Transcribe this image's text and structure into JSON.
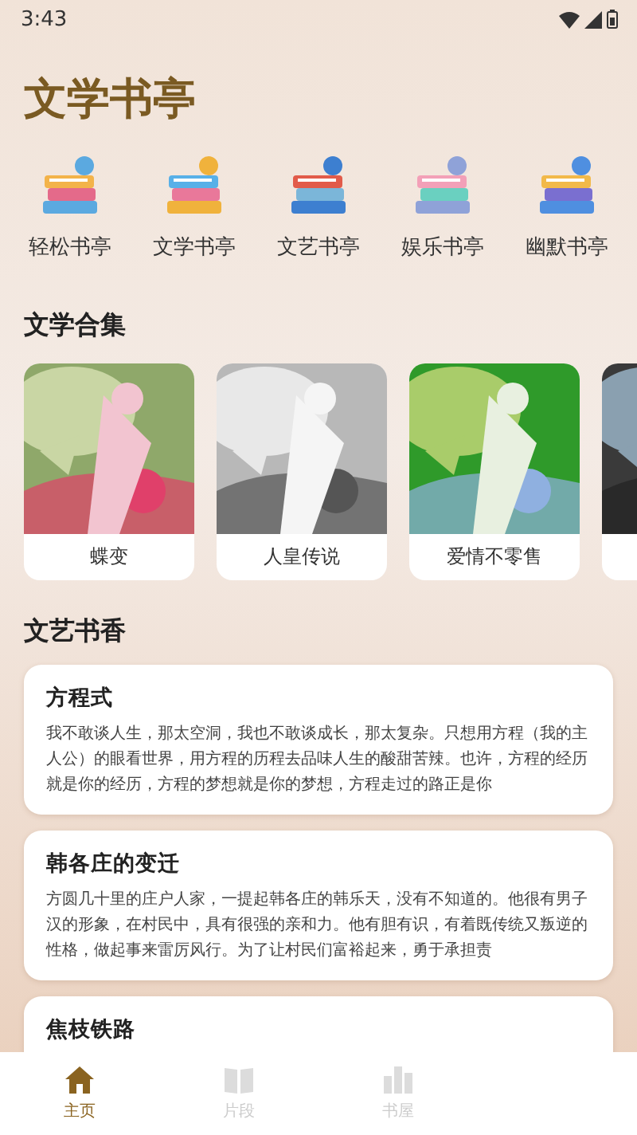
{
  "status_bar": {
    "time": "3:43"
  },
  "app_title": "文学书亭",
  "categories": [
    {
      "label": "轻松书亭"
    },
    {
      "label": "文学书亭"
    },
    {
      "label": "文艺书亭"
    },
    {
      "label": "娱乐书亭"
    },
    {
      "label": "幽默书亭"
    }
  ],
  "collection": {
    "title": "文学合集",
    "books": [
      {
        "title": "蝶变",
        "kind": "picture"
      },
      {
        "title": "人皇传说",
        "kind": "picture"
      },
      {
        "title": "爱情不零售",
        "kind": "picture"
      },
      {
        "kind": "picture"
      }
    ]
  },
  "articles": {
    "title": "文艺书香",
    "items": [
      {
        "title": "方程式",
        "excerpt": "我不敢谈人生，那太空洞，我也不敢谈成长，那太复杂。只想用方程（我的主人公）的眼看世界，用方程的历程去品味人生的酸甜苦辣。也许，方程的经历就是你的经历，方程的梦想就是你的梦想，方程走过的路正是你"
      },
      {
        "title": "韩各庄的变迁",
        "excerpt": "方圆几十里的庄户人家，一提起韩各庄的韩乐天，没有不知道的。他很有男子汉的形象，在村民中，具有很强的亲和力。他有胆有识，有着既传统又叛逆的性格，做起事来雷厉风行。为了让村民们富裕起来，勇于承担责"
      },
      {
        "title": "焦枝铁路"
      }
    ]
  },
  "bottom_nav": [
    {
      "label": "主页",
      "selected": true
    },
    {
      "label": "片段",
      "selected": false
    },
    {
      "label": "书屋",
      "selected": false
    }
  ]
}
